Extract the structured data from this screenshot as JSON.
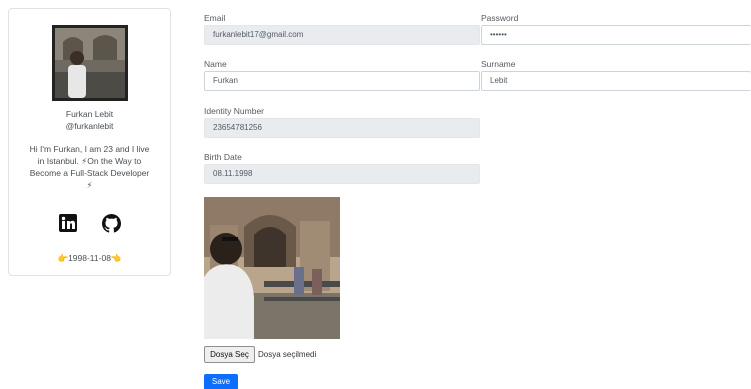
{
  "profile": {
    "name": "Furkan Lebit",
    "username": "@furkanlebit",
    "bio_line1": "Hi I'm Furkan, I am 23 and I live",
    "bio_line2": "in Istanbul. ⚡On the Way to",
    "bio_line3": "Become a Full-Stack Developer",
    "bio_line4": "⚡",
    "birth_date_display": "👉1998-11-08👈",
    "social": [
      "linkedin-icon",
      "github-icon"
    ]
  },
  "form": {
    "email_label": "Email",
    "email_value": "furkanlebit17@gmail.com",
    "password_label": "Password",
    "password_value": "••••••",
    "name_label": "Name",
    "name_value": "Furkan",
    "surname_label": "Surname",
    "surname_value": "Lebit",
    "identity_label": "Identity Number",
    "identity_value": "23654781256",
    "birth_label": "Birth Date",
    "birth_value": "08.11.1998",
    "file_button": "Dosya Seç",
    "file_status": "Dosya seçilmedi",
    "save_button": "Save"
  },
  "colors": {
    "primary": "#0d6efd",
    "disabled_bg": "#e9ecef",
    "border": "#ced4da"
  }
}
